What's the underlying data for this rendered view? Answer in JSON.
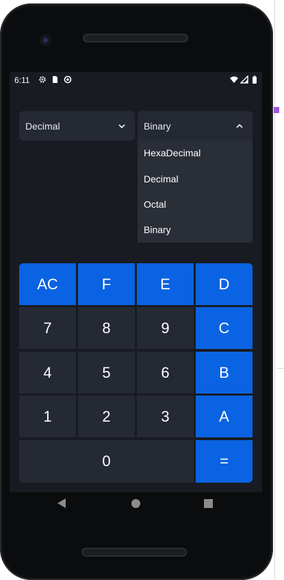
{
  "status_bar": {
    "time": "6:11",
    "icons": [
      "gear-icon",
      "sd-card-icon",
      "sync-icon",
      "wifi-icon",
      "signal-icon",
      "battery-icon"
    ]
  },
  "converter": {
    "from_select": {
      "value": "Decimal",
      "icon": "chevron-down-icon"
    },
    "to_select": {
      "value": "Binary",
      "icon": "chevron-up-icon",
      "expanded": true,
      "options": [
        "HexaDecimal",
        "Decimal",
        "Octal",
        "Binary"
      ]
    }
  },
  "keypad": {
    "rows": [
      [
        "AC",
        "F",
        "E",
        "D"
      ],
      [
        "7",
        "8",
        "9",
        "C"
      ],
      [
        "4",
        "5",
        "6",
        "B"
      ],
      [
        "1",
        "2",
        "3",
        "A"
      ],
      [
        "0",
        "="
      ]
    ]
  },
  "nav_bar": {
    "icons": [
      "back-icon",
      "home-icon",
      "recents-icon"
    ]
  },
  "colors": {
    "accent": "#0a63e2",
    "key_background": "#252933",
    "screen_background": "#181b22",
    "menu_background": "#2a2e37",
    "text": "#ffffff"
  }
}
